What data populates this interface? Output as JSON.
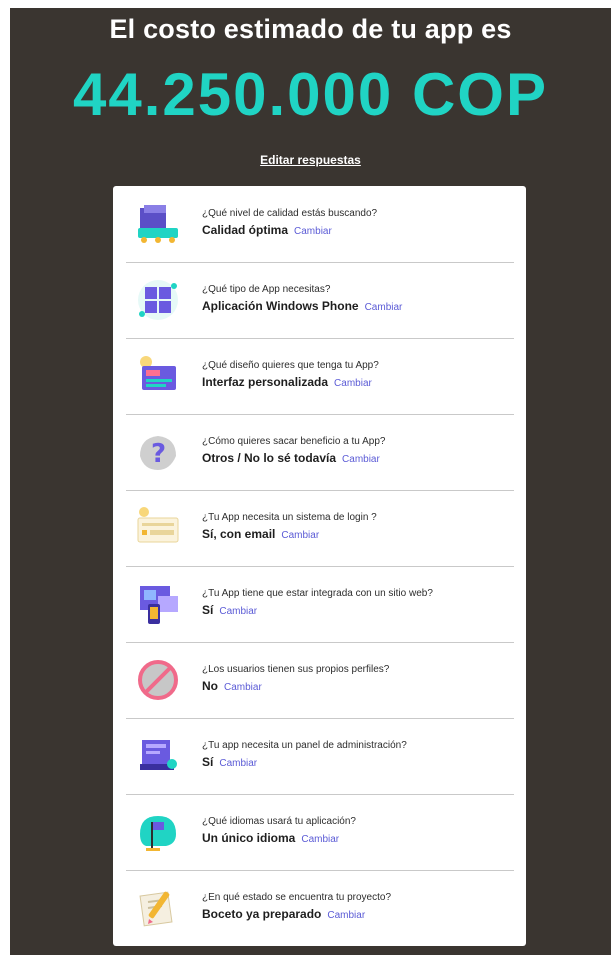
{
  "header": {
    "title": "El costo estimado de tu app es",
    "price": "44.250.000 COP",
    "edit_label": "Editar respuestas"
  },
  "colors": {
    "background": "#3a3530",
    "accent": "#20d4c4",
    "link": "#5b5bd6"
  },
  "items": [
    {
      "question": "¿Qué nivel de calidad estás buscando?",
      "answer": "Calidad óptima",
      "change": "Cambiar",
      "icon": "quality-icon"
    },
    {
      "question": "¿Qué tipo de App necesitas?",
      "answer": "Aplicación Windows Phone",
      "change": "Cambiar",
      "icon": "windows-icon"
    },
    {
      "question": "¿Qué diseño quieres que tenga tu App?",
      "answer": "Interfaz personalizada",
      "change": "Cambiar",
      "icon": "design-icon"
    },
    {
      "question": "¿Cómo quieres sacar beneficio a tu App?",
      "answer": "Otros / No lo sé todavía",
      "change": "Cambiar",
      "icon": "question-icon"
    },
    {
      "question": "¿Tu App necesita un sistema de login ?",
      "answer": "Sí, con email",
      "change": "Cambiar",
      "icon": "login-icon"
    },
    {
      "question": "¿Tu App tiene que estar integrada con un sitio web?",
      "answer": "Sí",
      "change": "Cambiar",
      "icon": "website-icon"
    },
    {
      "question": "¿Los usuarios tienen sus propios perfiles?",
      "answer": "No",
      "change": "Cambiar",
      "icon": "no-icon"
    },
    {
      "question": "¿Tu app necesita un panel de administración?",
      "answer": "Sí",
      "change": "Cambiar",
      "icon": "admin-panel-icon"
    },
    {
      "question": "¿Qué idiomas usará tu aplicación?",
      "answer": "Un único idioma",
      "change": "Cambiar",
      "icon": "language-icon"
    },
    {
      "question": "¿En qué estado se encuentra tu proyecto?",
      "answer": "Boceto ya preparado",
      "change": "Cambiar",
      "icon": "sketch-icon"
    }
  ]
}
